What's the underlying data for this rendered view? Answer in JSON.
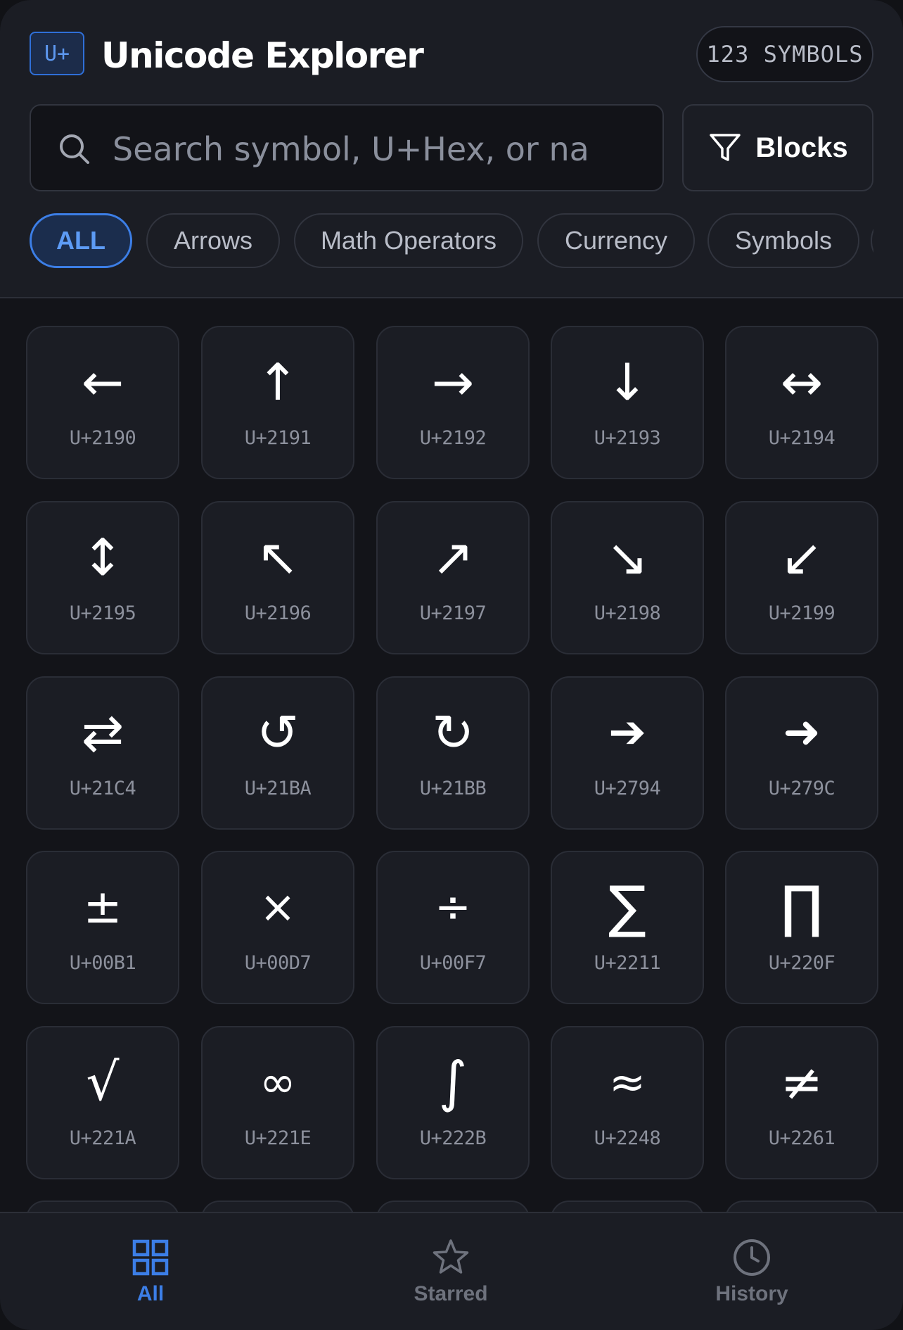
{
  "header": {
    "logo_text": "U+",
    "title": "Unicode Explorer",
    "count_badge": "123 SYMBOLS"
  },
  "search": {
    "placeholder": "Search symbol, U+Hex, or name",
    "value": ""
  },
  "blocks_button": {
    "label": "Blocks",
    "icon": "filter-icon"
  },
  "filters": [
    {
      "label": "ALL",
      "active": true
    },
    {
      "label": "Arrows",
      "active": false
    },
    {
      "label": "Math Operators",
      "active": false
    },
    {
      "label": "Currency",
      "active": false
    },
    {
      "label": "Symbols",
      "active": false
    }
  ],
  "symbols": [
    {
      "char": "←",
      "code": "U+2190"
    },
    {
      "char": "↑",
      "code": "U+2191"
    },
    {
      "char": "→",
      "code": "U+2192"
    },
    {
      "char": "↓",
      "code": "U+2193"
    },
    {
      "char": "↔",
      "code": "U+2194"
    },
    {
      "char": "↕",
      "code": "U+2195"
    },
    {
      "char": "↖",
      "code": "U+2196"
    },
    {
      "char": "↗",
      "code": "U+2197"
    },
    {
      "char": "↘",
      "code": "U+2198"
    },
    {
      "char": "↙",
      "code": "U+2199"
    },
    {
      "char": "⇄",
      "code": "U+21C4"
    },
    {
      "char": "↺",
      "code": "U+21BA"
    },
    {
      "char": "↻",
      "code": "U+21BB"
    },
    {
      "char": "➔",
      "code": "U+2794"
    },
    {
      "char": "➜",
      "code": "U+279C"
    },
    {
      "char": "±",
      "code": "U+00B1"
    },
    {
      "char": "×",
      "code": "U+00D7"
    },
    {
      "char": "÷",
      "code": "U+00F7"
    },
    {
      "char": "∑",
      "code": "U+2211"
    },
    {
      "char": "∏",
      "code": "U+220F"
    },
    {
      "char": "√",
      "code": "U+221A"
    },
    {
      "char": "∞",
      "code": "U+221E"
    },
    {
      "char": "∫",
      "code": "U+222B"
    },
    {
      "char": "≈",
      "code": "U+2248"
    },
    {
      "char": "≠",
      "code": "U+2261"
    }
  ],
  "bottom_nav": [
    {
      "label": "All",
      "icon": "grid-icon",
      "active": true
    },
    {
      "label": "Starred",
      "icon": "star-icon",
      "active": false
    },
    {
      "label": "History",
      "icon": "clock-icon",
      "active": false
    }
  ],
  "colors": {
    "accent": "#3c7ee6",
    "background": "#131419",
    "surface": "#1b1d24"
  }
}
